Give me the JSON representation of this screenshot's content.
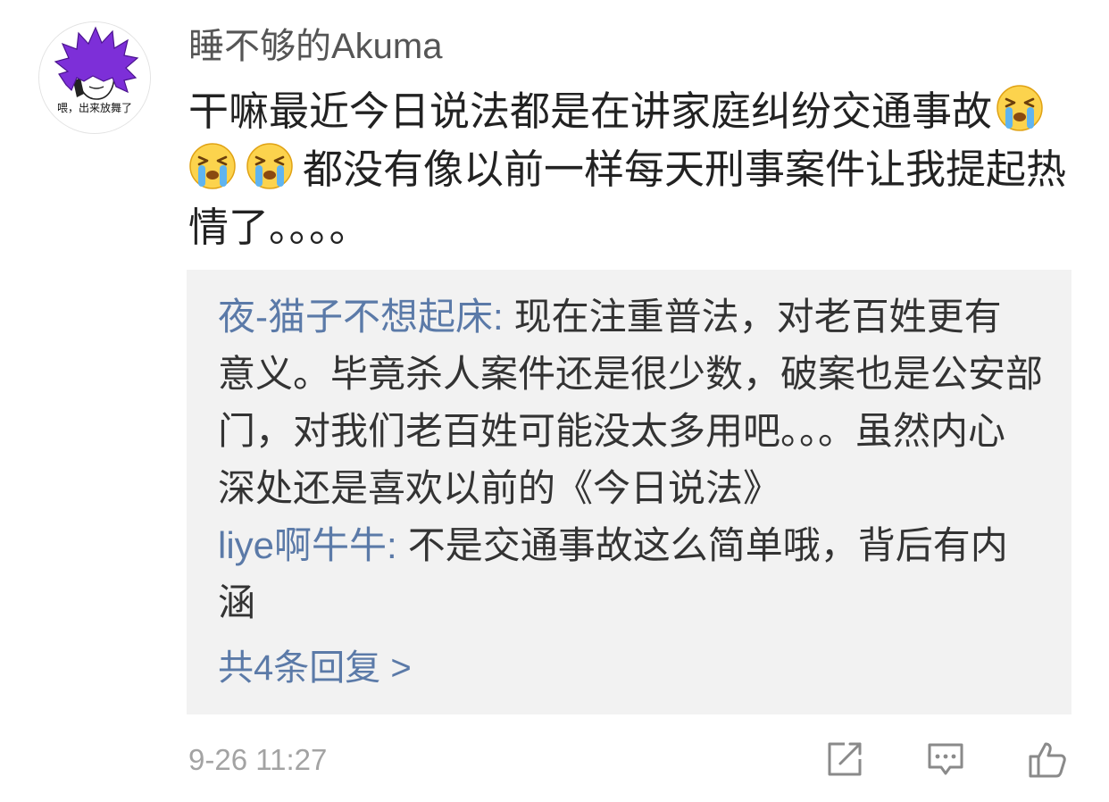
{
  "comment": {
    "author": "睡不够的Akuma",
    "avatar": {
      "icon": "avatar-purple-spiky-hair",
      "caption": "喂，出来放舞了"
    },
    "text_lines": [
      "干嘛最近今日说法都是在讲家庭纠纷交通事故",
      "都没有像以前一样每天刑事案件让我提起热",
      "情了。。。。"
    ],
    "emoji": "loudly-crying-face",
    "time": "9-26 11:27"
  },
  "replies": {
    "items": [
      {
        "author": "夜-猫子不想起床",
        "separator": ":",
        "text_lines": [
          "现在注重普法，对老百姓更有",
          "意义。毕竟杀人案件还是很少数，破案也是公安部",
          "门，对我们老百姓可能没太多用吧。。。虽然内心",
          "深处还是喜欢以前的《今日说法》"
        ]
      },
      {
        "author": "liye啊牛牛",
        "separator": ":",
        "text_lines": [
          "不是交通事故这么简单哦，背后有内",
          "涵"
        ]
      }
    ],
    "more_label": "共4条回复 >"
  },
  "actions": [
    {
      "icon": "repost-icon"
    },
    {
      "icon": "comment-icon"
    },
    {
      "icon": "like-icon"
    }
  ],
  "colors": {
    "link": "#5b7aa8",
    "text": "#222222",
    "muted": "#a3a3a3",
    "icon": "#8a8a8a",
    "reply_bg": "#f2f2f2",
    "avatar_hair": "#7d2fd8",
    "emoji_face": "#fcd34d",
    "emoji_tear": "#5fb4f0"
  }
}
